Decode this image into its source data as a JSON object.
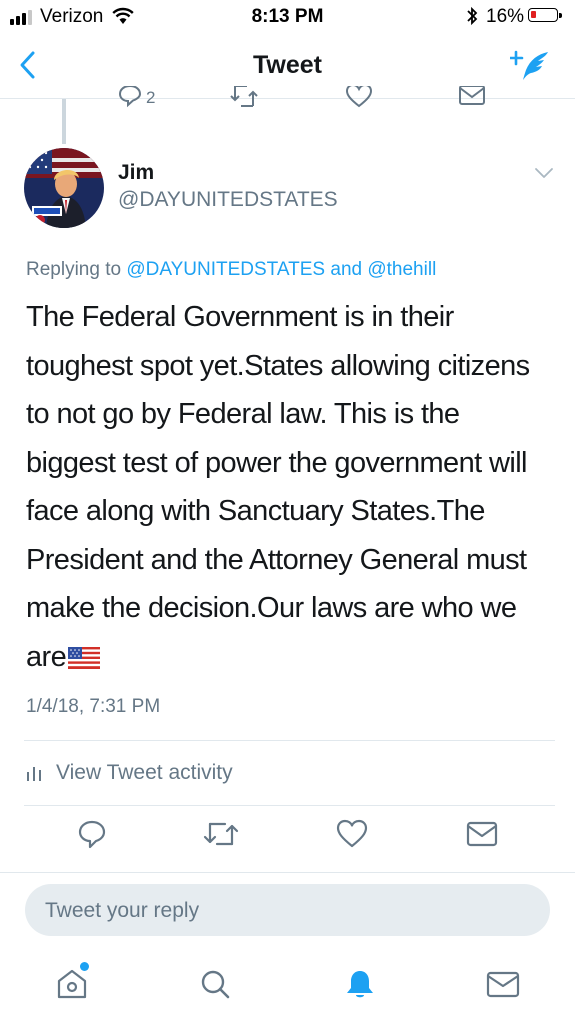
{
  "status_bar": {
    "carrier": "Verizon",
    "time": "8:13 PM",
    "battery_percent": "16%",
    "battery_level": 0.16,
    "icons": [
      "signal-icon",
      "wifi-icon",
      "bluetooth-icon",
      "battery-icon"
    ]
  },
  "nav": {
    "title": "Tweet",
    "back_icon": "chevron-left-icon",
    "compose_icon": "compose-tweet-icon"
  },
  "previous_tweet": {
    "reply_count": "2"
  },
  "tweet": {
    "author_name": "Jim",
    "author_handle": "@DAYUNITEDSTATES",
    "replying_prefix": "Replying to ",
    "replying_user1": "@DAYUNITEDSTATES",
    "replying_and": " and ",
    "replying_user2": "@thehill",
    "text": "The Federal Government is in their toughest spot yet.States allowing citizens to not go by Federal law. This is the biggest test of power the government will face along with Sanctuary States.The President and the Attorney General must make the decision.Our laws are who we are",
    "timestamp": "1/4/18, 7:31 PM",
    "activity_label": "View Tweet activity"
  },
  "reply_box": {
    "placeholder": "Tweet your reply"
  },
  "tabbar": {
    "items": [
      "home-icon",
      "search-icon",
      "notifications-icon",
      "messages-icon"
    ],
    "accent_color": "#1da1f2"
  },
  "colors": {
    "accent": "#1da1f2",
    "secondary_text": "#657786",
    "divider": "#e1e8ed"
  }
}
